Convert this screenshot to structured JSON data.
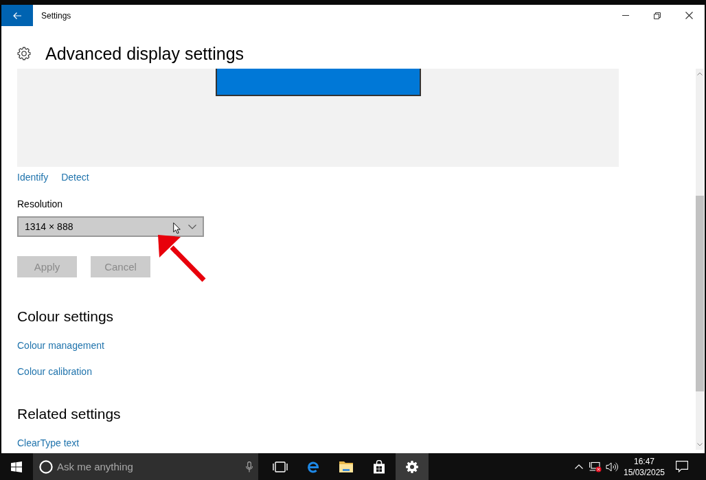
{
  "window": {
    "title": "Settings"
  },
  "page": {
    "title": "Advanced display settings"
  },
  "display_links": [
    {
      "label": "Identify"
    },
    {
      "label": "Detect"
    }
  ],
  "resolution": {
    "label": "Resolution",
    "value": "1314 × 888"
  },
  "buttons": [
    {
      "label": "Apply",
      "disabled": true
    },
    {
      "label": "Cancel",
      "disabled": true
    }
  ],
  "sections": [
    {
      "title": "Colour settings",
      "links": [
        {
          "label": "Colour management"
        },
        {
          "label": "Colour calibration"
        }
      ]
    },
    {
      "title": "Related settings",
      "links": [
        {
          "label": "ClearType text"
        }
      ]
    }
  ],
  "taskbar": {
    "search": {
      "placeholder": "Ask me anything"
    },
    "apps": [
      {
        "kind": "task-view",
        "selected": false
      },
      {
        "kind": "edge",
        "selected": false
      },
      {
        "kind": "explorer",
        "selected": false
      },
      {
        "kind": "store",
        "selected": false
      },
      {
        "kind": "settings",
        "selected": true
      }
    ],
    "clock": {
      "time": "16:47",
      "date": "15/03/2025"
    }
  }
}
